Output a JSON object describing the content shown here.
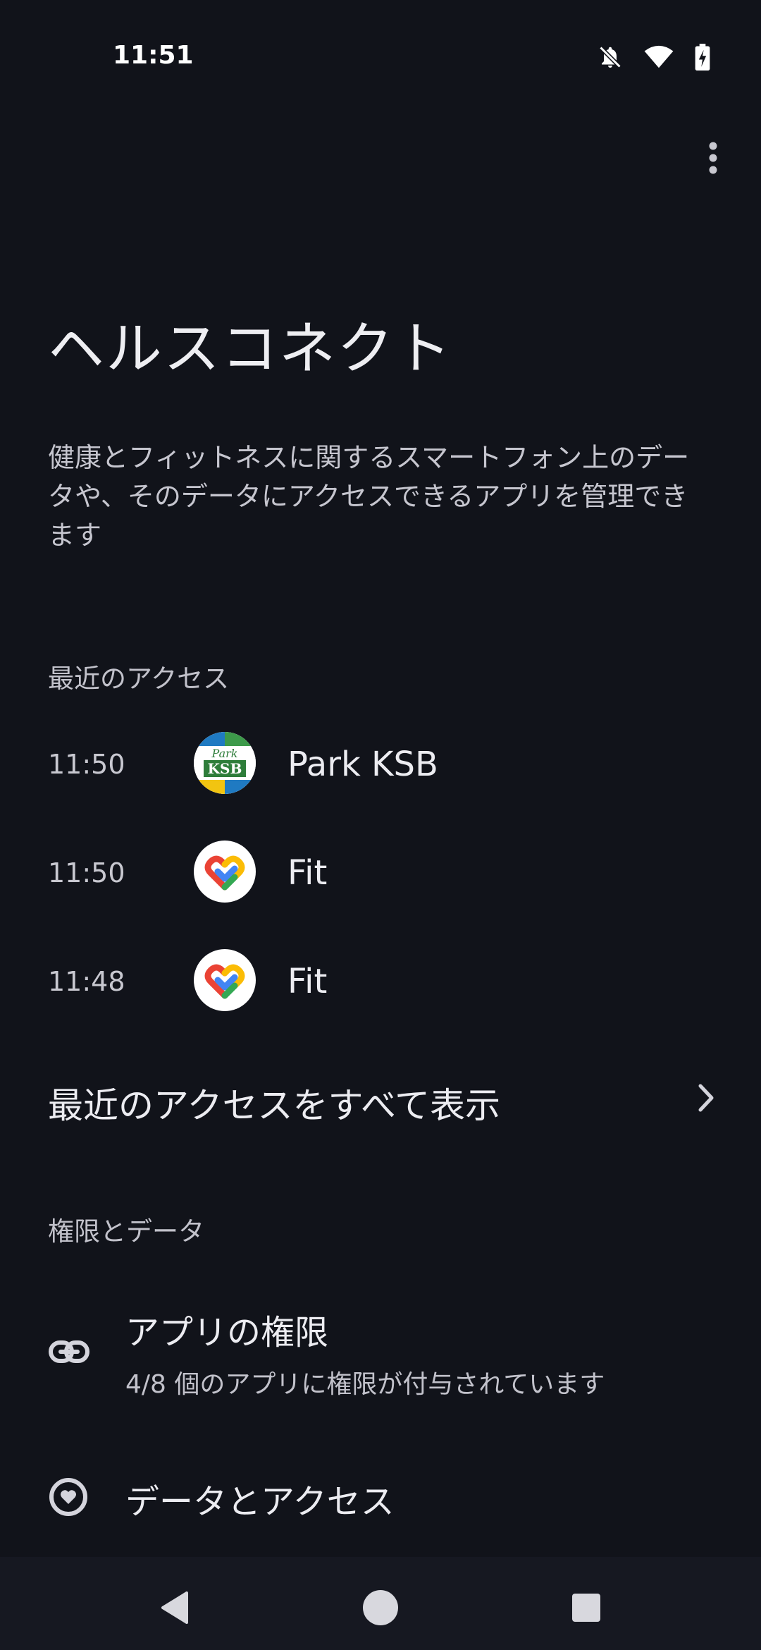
{
  "status_bar": {
    "time": "11:51",
    "icons": [
      "bell-off-icon",
      "wifi-icon",
      "battery-charging-icon"
    ]
  },
  "header": {
    "title": "ヘルスコネクト",
    "description": "健康とフィットネスに関するスマートフォン上のデータや、そのデータにアクセスできるアプリを管理できます"
  },
  "recent_access": {
    "header": "最近のアクセス",
    "items": [
      {
        "time": "11:50",
        "app": "Park KSB",
        "icon": "park-ksb-app-icon"
      },
      {
        "time": "11:50",
        "app": "Fit",
        "icon": "google-fit-icon"
      },
      {
        "time": "11:48",
        "app": "Fit",
        "icon": "google-fit-icon"
      }
    ],
    "see_all": "最近のアクセスをすべて表示"
  },
  "permissions": {
    "header": "権限とデータ",
    "app_permissions": {
      "title": "アプリの権限",
      "subtitle": "4/8 個のアプリに権限が付与されています",
      "icon": "link-icon"
    },
    "data_access": {
      "title": "データとアクセス",
      "icon": "data-heart-icon"
    }
  },
  "nav_bar": {
    "icons": [
      "back-icon",
      "home-icon",
      "recents-icon"
    ]
  },
  "colors": {
    "background": "#11131a",
    "text_primary": "#ececf1",
    "text_secondary": "#c2c2cb"
  }
}
